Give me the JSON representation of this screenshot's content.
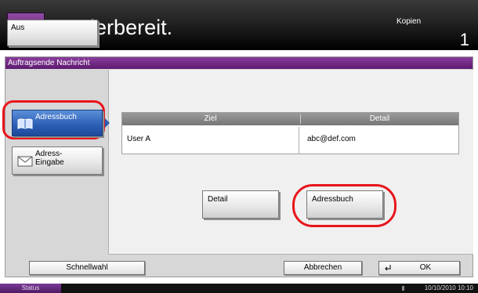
{
  "header": {
    "title": "Kopierbereit.",
    "right_label": "Kopien",
    "count": "1"
  },
  "panel": {
    "title": "Auftragsende Nachricht",
    "side_buttons": {
      "aus": "Aus",
      "adressbuch": "Adressbuch",
      "adress_eingabe_line1": "Adress-",
      "adress_eingabe_line2": "Eingabe"
    },
    "table": {
      "columns": [
        "Ziel",
        "Detail"
      ],
      "rows": [
        {
          "ziel": "User A",
          "detail": "abc@def.com"
        }
      ]
    },
    "buttons": {
      "detail": "Detail",
      "adressbuch": "Adressbuch"
    }
  },
  "bottom": {
    "schnellwahl": "Schnellwahl",
    "abbrechen": "Abbrechen",
    "ok": "OK"
  },
  "statusbar": {
    "status_label": "Status",
    "datetime": "10/10/2010  10:10"
  },
  "colors": {
    "accent_purple": "#6a2a80",
    "selected_blue": "#2b5db5",
    "highlight_red": "#e8151b"
  },
  "icons": [
    "copy-app-icon",
    "address-book-icon",
    "envelope-icon",
    "enter-icon"
  ]
}
